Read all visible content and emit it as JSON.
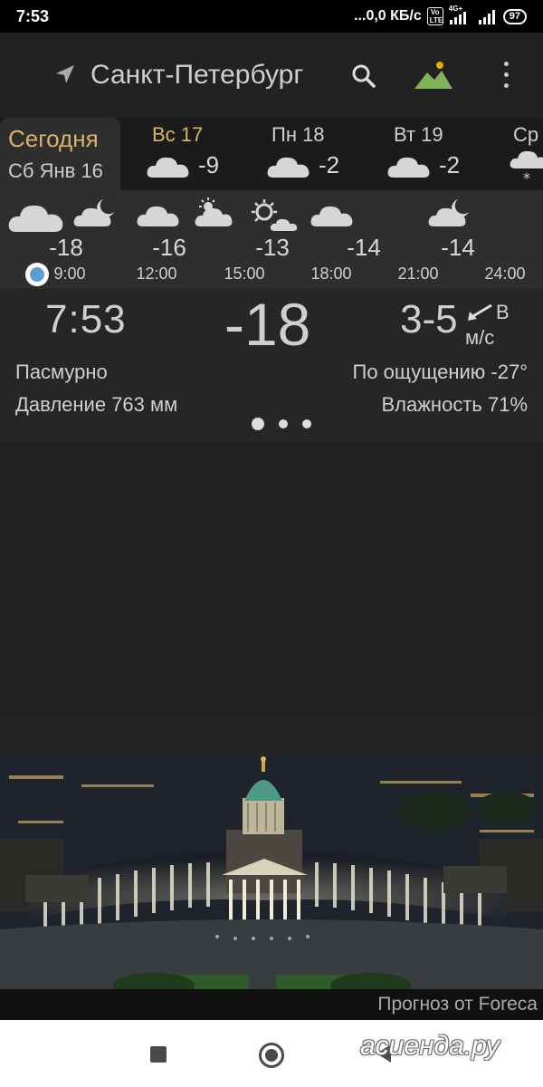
{
  "status_bar": {
    "time": "7:53",
    "network_speed": "...0,0 КБ/с",
    "volte_label": "Vo LTE",
    "network_type": "4G+",
    "battery": "97"
  },
  "toolbar": {
    "city": "Санкт-Петербург"
  },
  "days": {
    "today_label": "Сегодня",
    "today_date": "Сб Янв 16",
    "items": [
      {
        "name": "Вс 17",
        "temp": "-9",
        "icon": "cloud-icon"
      },
      {
        "name": "Пн 18",
        "temp": "-2",
        "icon": "cloud-icon"
      },
      {
        "name": "Вт 19",
        "temp": "-2",
        "icon": "cloud-icon"
      },
      {
        "name": "Ср",
        "temp": "",
        "icon": "snow-cloud-icon"
      }
    ]
  },
  "hourly": {
    "temps": [
      "-18",
      "-16",
      "-13",
      "-14",
      "-14"
    ],
    "times": [
      "9:00",
      "12:00",
      "15:00",
      "18:00",
      "21:00",
      "24:00"
    ]
  },
  "current": {
    "time": "7:53",
    "temp": "-18",
    "wind": "3-5",
    "wind_dir": "В",
    "wind_unit": "м/с",
    "condition": "Пасмурно",
    "feels_like": "По ощущению -27°",
    "pressure": "Давление 763 мм",
    "humidity": "Влажность 71%",
    "page_indicator": {
      "pages": 3,
      "active": 1
    }
  },
  "credit": "Прогноз от Foreca",
  "watermark": "асиенда.ру",
  "colors": {
    "accent_gold": "#d9b36a",
    "background": "#222222",
    "now_marker": "#5a9fd0"
  }
}
